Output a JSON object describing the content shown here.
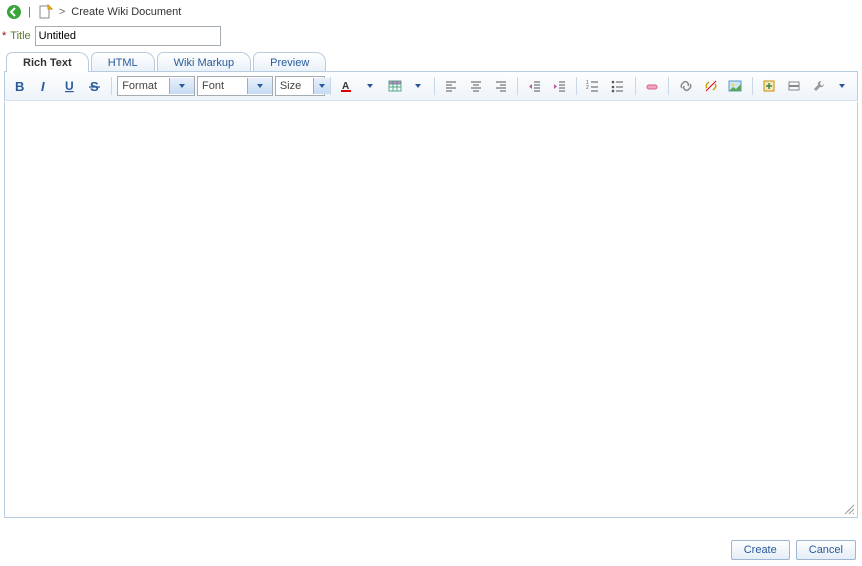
{
  "header": {
    "title": "Create Wiki Document"
  },
  "form": {
    "titleLabel": "Title",
    "titleValue": "Untitled"
  },
  "tabs": [
    "Rich Text",
    "HTML",
    "Wiki Markup",
    "Preview"
  ],
  "toolbar": {
    "format": "Format",
    "font": "Font",
    "size": "Size"
  },
  "buttons": {
    "create": "Create",
    "cancel": "Cancel"
  }
}
